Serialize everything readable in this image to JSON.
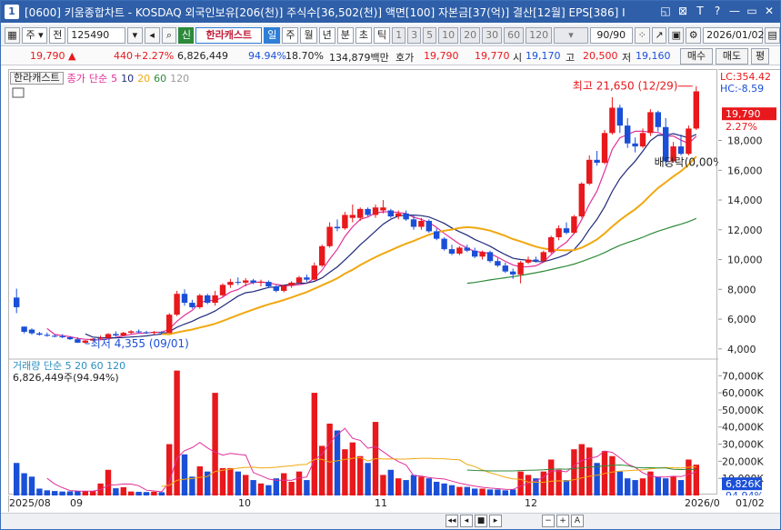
{
  "title": {
    "num": "1",
    "text": "[0600] 키움종합차트 - KOSDAQ 외국인보유[206(천)] 주식수[36,502(천)] 액면[100] 자본금[37(억)] 결산[12월] EPS[386] I",
    "buttons": [
      "◱",
      "⊠",
      "T",
      "?",
      "—",
      "▭",
      "✕"
    ]
  },
  "toolbar": {
    "type_label": "주",
    "range_label": "전",
    "code": "125490",
    "stock_name": "한라캐스트",
    "periods": [
      "일",
      "주",
      "월",
      "년",
      "분",
      "초",
      "틱"
    ],
    "intervals": [
      "1",
      "3",
      "5",
      "10",
      "20",
      "30",
      "60",
      "120"
    ],
    "count": "90/90",
    "date": "2026/01/02"
  },
  "quote": {
    "price": "19,790",
    "change": "440",
    "change_pct": "+2.27%",
    "volume": "6,826,449",
    "vol_ratio": "94.94%",
    "turnover": "18.70%",
    "amount": "134,879백만",
    "bid_label": "호가",
    "bid": "19,790",
    "ask": "19,770",
    "open_label": "시",
    "open": "19,170",
    "high_label": "고",
    "high": "20,500",
    "low_label": "저",
    "low": "19,160",
    "buy_button": "매수",
    "sell_button": "매도",
    "eval_button": "평"
  },
  "legend": {
    "name": "한라캐스트",
    "price_label": "종가",
    "ma_label": "단순",
    "ma_periods": [
      "5",
      "10",
      "20",
      "60",
      "120"
    ],
    "ma_colors": [
      "#e0309a",
      "#1f2a7a",
      "#f0a810",
      "#2e8a3a",
      "#9a9a9a"
    ]
  },
  "volume_legend": {
    "label": "거래량",
    "ma_label": "단순",
    "periods": [
      "5",
      "20",
      "60",
      "120"
    ],
    "value_text": "6,826,449주(94.94%)"
  },
  "annotations": {
    "high": "최고 21,650 (12/29)",
    "low": "최저 4,355 (09/01)",
    "dividend": "배당락(0,00%)"
  },
  "right_axis": {
    "lc": "LC:354.42",
    "hc": "HC:-8.59",
    "price_tag": "19,790",
    "pct_tag": "2.27%",
    "price_ticks": [
      "18,000",
      "16,000",
      "14,000",
      "12,000",
      "10,000",
      "8,000",
      "6,000",
      "4,000"
    ],
    "vol_ticks": [
      "70,000K",
      "60,000K",
      "50,000K",
      "40,000K",
      "30,000K",
      "20,000K",
      "10,000K"
    ],
    "vol_tag": "6,826K",
    "vol_pct_tag": "94.94%"
  },
  "date_axis": [
    "2025/08",
    "09",
    "10",
    "11",
    "12",
    "2026/0",
    "01/02"
  ],
  "chart_data": {
    "type": "candlestick",
    "title": "",
    "xlabel": "",
    "ylabel": "",
    "ylim": [
      3500,
      22000
    ],
    "volume_ylim": [
      0,
      76000
    ],
    "candles": [
      [
        7450,
        8050,
        6400,
        6800,
        19000,
        0
      ],
      [
        5500,
        5500,
        5050,
        5150,
        13000,
        0
      ],
      [
        5300,
        5380,
        4950,
        5050,
        11000,
        0
      ],
      [
        5050,
        5150,
        4900,
        4950,
        4000,
        0
      ],
      [
        4950,
        5100,
        4820,
        4880,
        3000,
        0
      ],
      [
        4880,
        4960,
        4780,
        4820,
        2600,
        0
      ],
      [
        4850,
        4980,
        4720,
        4780,
        2300,
        0
      ],
      [
        4780,
        4860,
        4600,
        4650,
        2400,
        0
      ],
      [
        4650,
        4780,
        4400,
        4420,
        2600,
        0
      ],
      [
        4420,
        4600,
        4355,
        4560,
        2600,
        1
      ],
      [
        4560,
        4720,
        4500,
        4680,
        2600,
        1
      ],
      [
        4680,
        4900,
        4620,
        4740,
        7000,
        1
      ],
      [
        4740,
        5060,
        4700,
        5000,
        15000,
        1
      ],
      [
        5000,
        5180,
        4850,
        4900,
        4200,
        0
      ],
      [
        4900,
        5150,
        4880,
        5080,
        4800,
        1
      ],
      [
        5080,
        5260,
        5000,
        5180,
        2300,
        1
      ],
      [
        5180,
        5300,
        5060,
        5120,
        2100,
        0
      ],
      [
        5120,
        5220,
        5000,
        5080,
        2000,
        0
      ],
      [
        5080,
        5200,
        4960,
        5140,
        2200,
        1
      ],
      [
        5140,
        5200,
        5000,
        5060,
        1900,
        0
      ],
      [
        5060,
        6400,
        5050,
        6300,
        30000,
        1
      ],
      [
        6300,
        7900,
        6200,
        7700,
        73000,
        1
      ],
      [
        7700,
        8000,
        6900,
        7100,
        24000,
        0
      ],
      [
        7100,
        7300,
        6700,
        6800,
        11000,
        0
      ],
      [
        6800,
        7700,
        6700,
        7600,
        17000,
        1
      ],
      [
        7600,
        7700,
        7000,
        7100,
        14000,
        0
      ],
      [
        7100,
        7900,
        6900,
        7600,
        60000,
        1
      ],
      [
        7600,
        8400,
        7500,
        8300,
        16000,
        1
      ],
      [
        8300,
        8700,
        8100,
        8500,
        16000,
        1
      ],
      [
        8500,
        8800,
        8300,
        8450,
        14000,
        0
      ],
      [
        8450,
        8750,
        8200,
        8600,
        12000,
        1
      ],
      [
        8600,
        8700,
        8350,
        8450,
        9000,
        0
      ],
      [
        8450,
        8650,
        8200,
        8500,
        7000,
        1
      ],
      [
        8500,
        8600,
        8100,
        8200,
        6000,
        0
      ],
      [
        8200,
        8300,
        7800,
        7900,
        10000,
        0
      ],
      [
        7900,
        8300,
        7800,
        8250,
        13000,
        1
      ],
      [
        8250,
        8550,
        8100,
        8450,
        8000,
        1
      ],
      [
        8450,
        8900,
        8400,
        8800,
        14000,
        1
      ],
      [
        8800,
        9000,
        8500,
        8650,
        9000,
        0
      ],
      [
        8650,
        9800,
        8600,
        9600,
        60000,
        1
      ],
      [
        9600,
        11000,
        9500,
        10900,
        29000,
        1
      ],
      [
        10900,
        12500,
        10800,
        12200,
        42000,
        1
      ],
      [
        12200,
        12700,
        11900,
        12100,
        38000,
        0
      ],
      [
        12100,
        13200,
        12000,
        13000,
        27000,
        1
      ],
      [
        13000,
        13700,
        12500,
        12800,
        31000,
        1
      ],
      [
        12800,
        13500,
        12600,
        13400,
        23000,
        1
      ],
      [
        13400,
        13500,
        12900,
        13000,
        19000,
        0
      ],
      [
        13000,
        13700,
        12800,
        13500,
        43000,
        1
      ],
      [
        13500,
        14000,
        13100,
        13300,
        12000,
        1
      ],
      [
        13300,
        13400,
        12800,
        12900,
        15000,
        0
      ],
      [
        12900,
        13300,
        12700,
        13100,
        10000,
        1
      ],
      [
        13100,
        13300,
        12600,
        12700,
        9000,
        0
      ],
      [
        12700,
        13000,
        12000,
        12200,
        12000,
        0
      ],
      [
        12200,
        12800,
        12000,
        12600,
        11000,
        1
      ],
      [
        12600,
        12700,
        11800,
        11900,
        10000,
        0
      ],
      [
        11900,
        12100,
        11300,
        11400,
        8000,
        0
      ],
      [
        11400,
        11500,
        10600,
        10700,
        7000,
        0
      ],
      [
        10700,
        11000,
        10300,
        10400,
        6000,
        0
      ],
      [
        10400,
        10900,
        10300,
        10800,
        5000,
        1
      ],
      [
        10800,
        11000,
        10500,
        10600,
        5000,
        0
      ],
      [
        10600,
        10800,
        10100,
        10200,
        4000,
        0
      ],
      [
        10200,
        10600,
        10000,
        10500,
        4000,
        1
      ],
      [
        10500,
        10600,
        9800,
        9900,
        3500,
        0
      ],
      [
        9900,
        10100,
        9500,
        9600,
        3500,
        0
      ],
      [
        9600,
        9800,
        9100,
        9200,
        3000,
        0
      ],
      [
        9200,
        9400,
        8700,
        9000,
        3500,
        0
      ],
      [
        9000,
        9900,
        8400,
        9800,
        14000,
        1
      ],
      [
        9800,
        10200,
        9700,
        10000,
        12000,
        1
      ],
      [
        10000,
        10200,
        9800,
        9900,
        10000,
        0
      ],
      [
        9900,
        10600,
        9800,
        10500,
        14000,
        1
      ],
      [
        10500,
        11600,
        10400,
        11500,
        21000,
        1
      ],
      [
        11500,
        12300,
        11300,
        12100,
        15000,
        1
      ],
      [
        12100,
        12500,
        11700,
        11800,
        9000,
        0
      ],
      [
        11800,
        13000,
        11700,
        12900,
        27000,
        1
      ],
      [
        12900,
        15200,
        12800,
        15100,
        30000,
        1
      ],
      [
        15100,
        17000,
        15000,
        16700,
        28000,
        1
      ],
      [
        16700,
        17300,
        16300,
        16500,
        19000,
        0
      ],
      [
        16500,
        18700,
        16400,
        18500,
        26000,
        1
      ],
      [
        18500,
        20900,
        18400,
        20200,
        23000,
        1
      ],
      [
        20200,
        20400,
        18500,
        19000,
        14000,
        0
      ],
      [
        19000,
        19500,
        17500,
        17800,
        10000,
        0
      ],
      [
        17800,
        18200,
        17200,
        17600,
        9000,
        0
      ],
      [
        17600,
        18800,
        17500,
        18500,
        10000,
        1
      ],
      [
        18500,
        20100,
        18300,
        19900,
        14000,
        1
      ],
      [
        19900,
        20000,
        18600,
        18900,
        11000,
        0
      ],
      [
        18900,
        19500,
        16300,
        16600,
        10000,
        0
      ],
      [
        16600,
        17900,
        16500,
        17600,
        11000,
        1
      ],
      [
        17600,
        18400,
        17000,
        17100,
        9000,
        0
      ],
      [
        17100,
        19000,
        17000,
        18800,
        21000,
        1
      ],
      [
        18800,
        21650,
        18700,
        21300,
        18000,
        1
      ]
    ]
  }
}
